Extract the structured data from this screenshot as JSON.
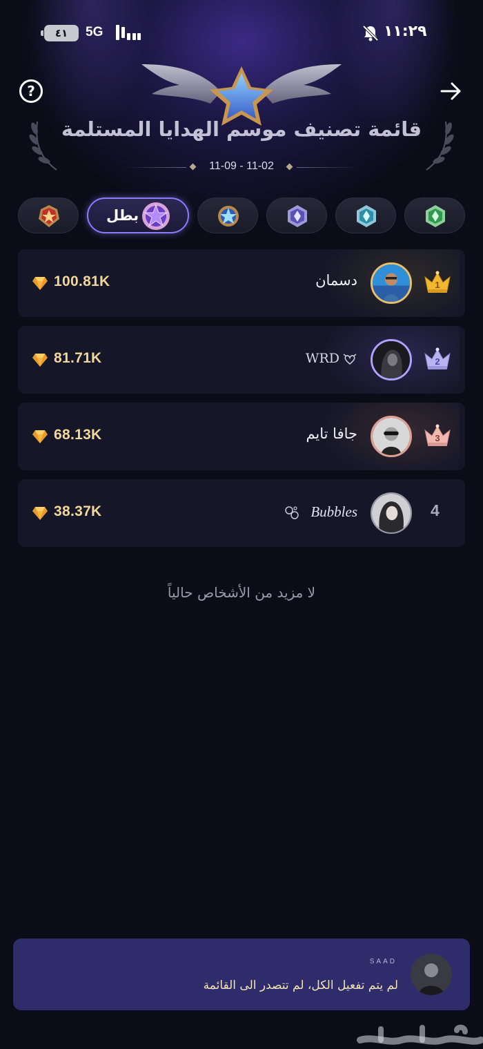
{
  "status_bar": {
    "battery": "٤١",
    "network": "5G",
    "time": "١١:٢٩"
  },
  "header": {
    "title": "قائمة تصنيف موسم الهدايا المستلمة",
    "date_range": "11-09 - 11-02"
  },
  "tiers": [
    {
      "icon": "green-diamond-badge-icon"
    },
    {
      "icon": "teal-diamond-badge-icon"
    },
    {
      "icon": "purple-diamond-badge-icon"
    },
    {
      "icon": "blue-star-badge-icon"
    },
    {
      "icon": "purple-star-champion-badge-icon",
      "label": "بطل",
      "active": true
    },
    {
      "icon": "red-star-badge-icon"
    }
  ],
  "leaderboard": [
    {
      "rank": "1",
      "name": "دسمان",
      "score": "100.81K",
      "crown": "gold-crown-icon"
    },
    {
      "rank": "2",
      "name": "WRD",
      "score": "81.71K",
      "crown": "silver-crown-icon"
    },
    {
      "rank": "3",
      "name": "جافا تايم",
      "score": "68.13K",
      "crown": "bronze-crown-icon"
    },
    {
      "rank": "4",
      "name": "Bubbles",
      "score": "38.37K"
    }
  ],
  "empty_message": "لا مزيد من الأشخاص حالياً",
  "notification": {
    "sender": "SAAD",
    "message": "لم يتم تفعيل الكل، لم تتصدر الى القائمة"
  },
  "colors": {
    "background": "#0c0c18",
    "row": "#151728",
    "score": "#f2d79a",
    "accent": "#8b7cff",
    "toast": "#2e2c6a"
  }
}
